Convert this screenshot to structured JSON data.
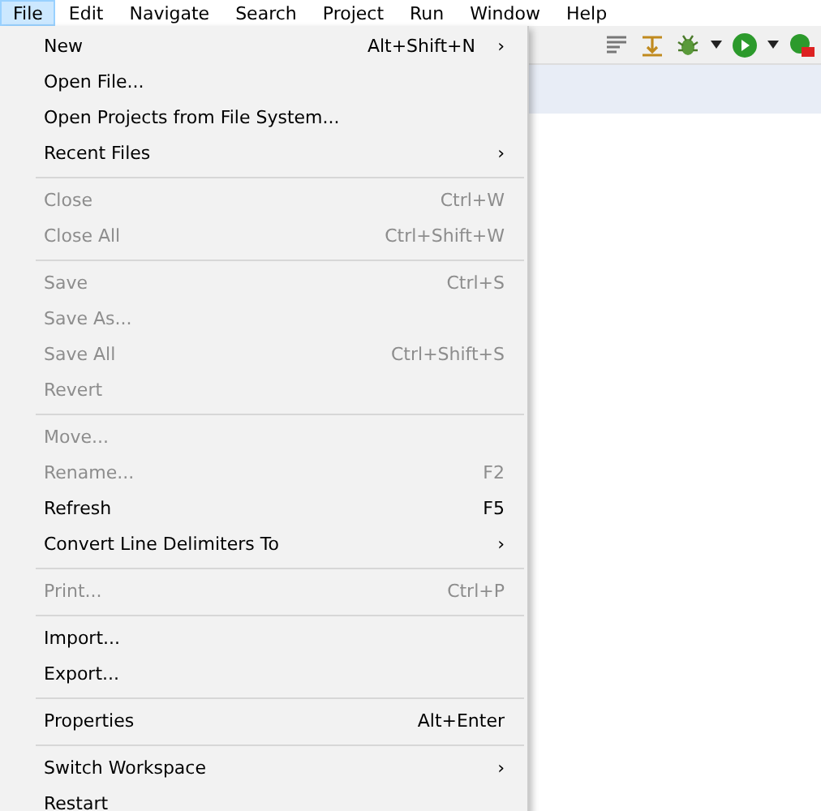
{
  "menubar": [
    {
      "label": "File",
      "selected": true
    },
    {
      "label": "Edit",
      "selected": false
    },
    {
      "label": "Navigate",
      "selected": false
    },
    {
      "label": "Search",
      "selected": false
    },
    {
      "label": "Project",
      "selected": false
    },
    {
      "label": "Run",
      "selected": false
    },
    {
      "label": "Window",
      "selected": false
    },
    {
      "label": "Help",
      "selected": false
    }
  ],
  "file_menu": [
    {
      "kind": "item",
      "label": "New",
      "shortcut": "Alt+Shift+N",
      "arrow": "›",
      "disabled": false
    },
    {
      "kind": "item",
      "label": "Open File...",
      "disabled": false
    },
    {
      "kind": "item",
      "label": "Open Projects from File System...",
      "disabled": false
    },
    {
      "kind": "item",
      "label": "Recent Files",
      "arrow": "›",
      "disabled": false
    },
    {
      "kind": "separator"
    },
    {
      "kind": "item",
      "label": "Close",
      "shortcut": "Ctrl+W",
      "disabled": true
    },
    {
      "kind": "item",
      "label": "Close All",
      "shortcut": "Ctrl+Shift+W",
      "disabled": true
    },
    {
      "kind": "separator"
    },
    {
      "kind": "item",
      "label": "Save",
      "shortcut": "Ctrl+S",
      "disabled": true
    },
    {
      "kind": "item",
      "label": "Save As...",
      "disabled": true
    },
    {
      "kind": "item",
      "label": "Save All",
      "shortcut": "Ctrl+Shift+S",
      "disabled": true
    },
    {
      "kind": "item",
      "label": "Revert",
      "disabled": true
    },
    {
      "kind": "separator"
    },
    {
      "kind": "item",
      "label": "Move...",
      "disabled": true
    },
    {
      "kind": "item",
      "label": "Rename...",
      "shortcut": "F2",
      "disabled": true
    },
    {
      "kind": "item",
      "label": "Refresh",
      "shortcut": "F5",
      "disabled": false
    },
    {
      "kind": "item",
      "label": "Convert Line Delimiters To",
      "arrow": "›",
      "disabled": false
    },
    {
      "kind": "separator"
    },
    {
      "kind": "item",
      "label": "Print...",
      "shortcut": "Ctrl+P",
      "disabled": true
    },
    {
      "kind": "separator"
    },
    {
      "kind": "item",
      "label": "Import...",
      "disabled": false
    },
    {
      "kind": "item",
      "label": "Export...",
      "disabled": false
    },
    {
      "kind": "separator"
    },
    {
      "kind": "item",
      "label": "Properties",
      "shortcut": "Alt+Enter",
      "disabled": false
    },
    {
      "kind": "separator"
    },
    {
      "kind": "item",
      "label": "Switch Workspace",
      "arrow": "›",
      "disabled": false
    },
    {
      "kind": "item",
      "label": "Restart",
      "disabled": false
    }
  ]
}
